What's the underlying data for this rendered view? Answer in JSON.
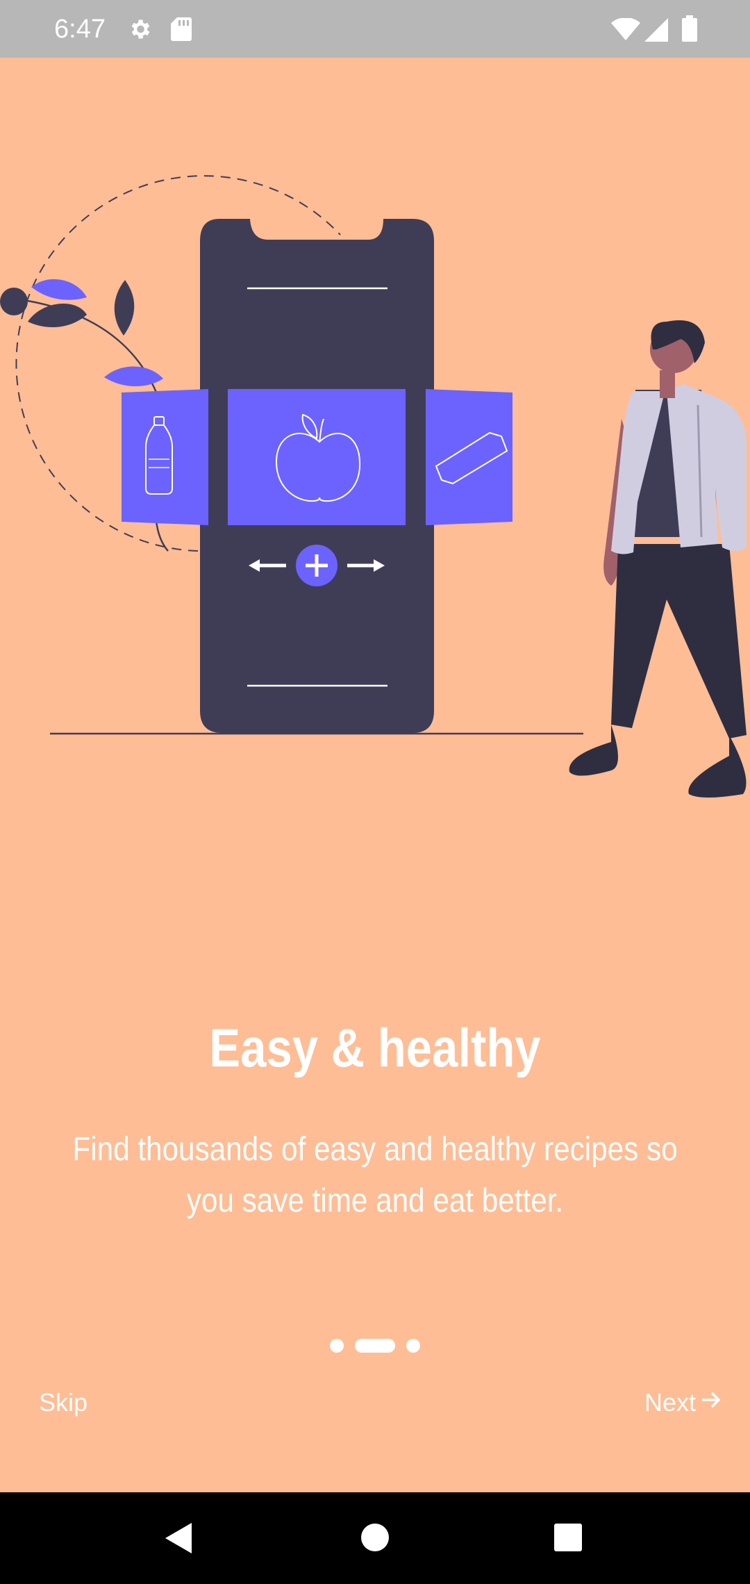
{
  "status_bar": {
    "time": "6:47",
    "icons": [
      "gear-icon",
      "sd-card-icon",
      "wifi-icon",
      "signal-icon",
      "battery-icon"
    ]
  },
  "onboarding": {
    "title": "Easy & healthy",
    "subtitle": "Find thousands of easy and healthy recipes so you save time and eat better.",
    "page_indicator": {
      "total": 3,
      "current": 2
    },
    "skip_label": "Skip",
    "next_label": "Next",
    "colors": {
      "background": "#FFBD95",
      "accent": "#6C63FF",
      "phone": "#3F3D56",
      "text": "#FFFFFF"
    }
  },
  "nav_bar": {
    "buttons": [
      "back-icon",
      "home-icon",
      "recents-icon"
    ]
  }
}
